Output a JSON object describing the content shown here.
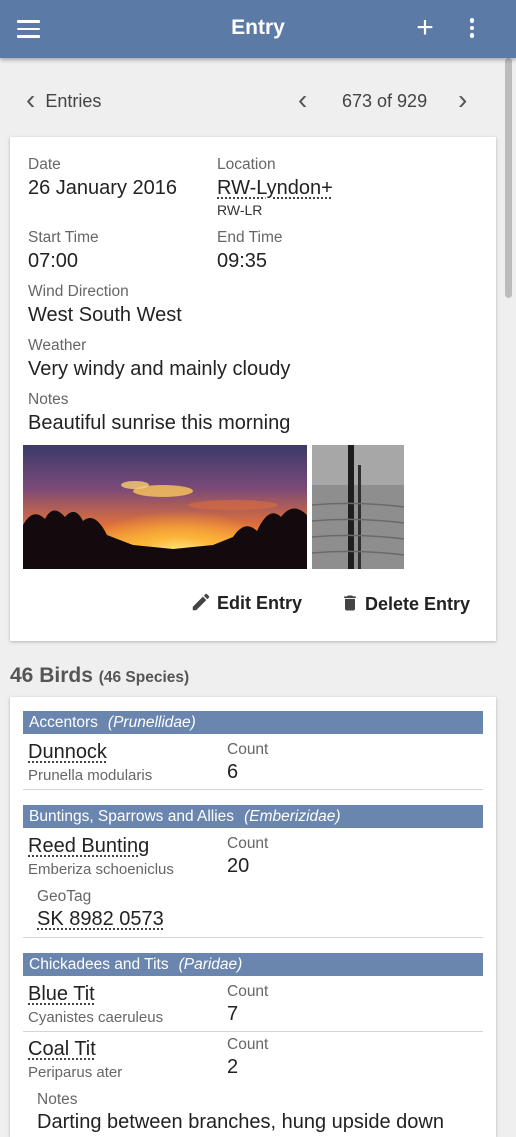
{
  "app_bar": {
    "title": "Entry",
    "add_symbol": "+"
  },
  "nav": {
    "back_label": "Entries",
    "counter": "673 of 929"
  },
  "entry": {
    "date_label": "Date",
    "date": "26 January 2016",
    "location_label": "Location",
    "location": "RW-Lyndon+",
    "location_code": "RW-LR",
    "start_label": "Start Time",
    "start": "07:00",
    "end_label": "End Time",
    "end": "09:35",
    "wind_label": "Wind Direction",
    "wind": "West South West",
    "weather_label": "Weather",
    "weather": "Very windy and mainly cloudy",
    "notes_label": "Notes",
    "notes": "Beautiful sunrise this morning"
  },
  "actions": {
    "edit": "Edit Entry",
    "delete": "Delete Entry"
  },
  "birds": {
    "count": "46 Birds",
    "species": "(46 Species)",
    "count_label": "Count",
    "geotag_label": "GeoTag",
    "notes_label": "Notes",
    "families": [
      {
        "name": "Accentors",
        "latin": "(Prunellidae)"
      },
      {
        "name": "Buntings, Sparrows and Allies",
        "latin": "(Emberizidae)"
      },
      {
        "name": "Chickadees and Tits",
        "latin": "(Paridae)"
      }
    ],
    "items": [
      {
        "name": "Dunnock",
        "latin": "Prunella modularis",
        "count": "6"
      },
      {
        "name": "Reed Bunting",
        "latin": "Emberiza schoeniclus",
        "count": "20",
        "geotag": "SK 8982 0573"
      },
      {
        "name": "Blue Tit",
        "latin": "Cyanistes caeruleus",
        "count": "7"
      },
      {
        "name": "Coal Tit",
        "latin": "Periparus ater",
        "count": "2",
        "notes": "Darting between branches, hung upside down"
      }
    ]
  }
}
